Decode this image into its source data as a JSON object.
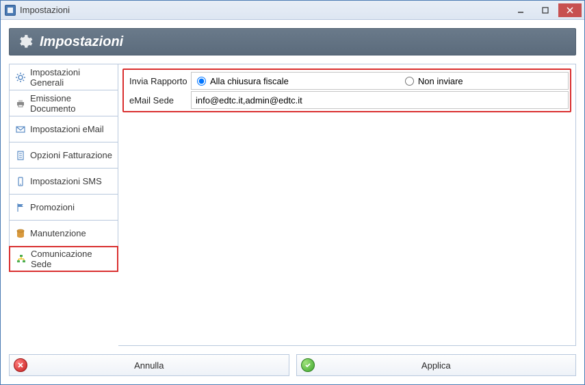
{
  "window": {
    "title": "Impostazioni"
  },
  "header": {
    "title": "Impostazioni"
  },
  "sidebar": {
    "items": [
      {
        "label": "Impostazioni Generali",
        "icon": "gear"
      },
      {
        "label": "Emissione Documento",
        "icon": "printer"
      },
      {
        "label": "Impostazioni eMail",
        "icon": "mail"
      },
      {
        "label": "Opzioni Fatturazione",
        "icon": "doc"
      },
      {
        "label": "Impostazioni SMS",
        "icon": "phone"
      },
      {
        "label": "Promozioni",
        "icon": "flag"
      },
      {
        "label": "Manutenzione",
        "icon": "db"
      },
      {
        "label": "Comunicazione Sede",
        "icon": "org"
      }
    ],
    "active_index": 7
  },
  "form": {
    "invia_rapporto": {
      "label": "Invia Rapporto",
      "options": [
        {
          "label": "Alla chiusura fiscale",
          "selected": true
        },
        {
          "label": "Non inviare",
          "selected": false
        }
      ]
    },
    "email_sede": {
      "label": "eMail Sede",
      "value": "info@edtc.it,admin@edtc.it"
    }
  },
  "footer": {
    "cancel": "Annulla",
    "apply": "Applica"
  }
}
